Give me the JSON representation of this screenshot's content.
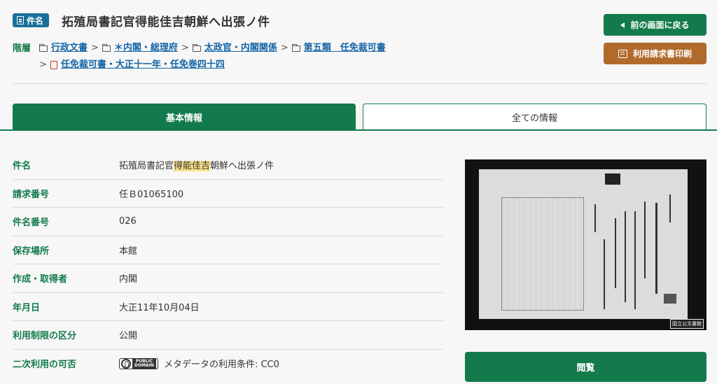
{
  "header": {
    "badge_label": "件名",
    "title": "拓殖局書記官得能佳吉朝鮮へ出張ノ件"
  },
  "breadcrumb": {
    "label": "階層",
    "sep": ">",
    "items": [
      {
        "label": "行政文書",
        "icon": "folder-icon"
      },
      {
        "label": "＊内閣・総理府",
        "icon": "folder-icon"
      },
      {
        "label": "太政官・内閣関係",
        "icon": "folder-icon"
      },
      {
        "label": "第五類　任免裁可書",
        "icon": "folder-icon"
      },
      {
        "label": "任免裁可書・大正十一年・任免巻四十四",
        "icon": "book-icon"
      }
    ]
  },
  "actions": {
    "back_label": "前の画面に戻る",
    "print_label": "利用請求書印刷",
    "view_label": "閲覧"
  },
  "tabs": {
    "basic": "基本情報",
    "all": "全ての情報"
  },
  "metadata": {
    "title_label": "件名",
    "title_pre": "拓殖局書記官",
    "title_hl": "得能佳吉",
    "title_post": "朝鮮へ出張ノ件",
    "request_label": "請求番号",
    "request_value": "任Ｂ01065100",
    "number_label": "件名番号",
    "number_value": "026",
    "location_label": "保存場所",
    "location_value": "本館",
    "creator_label": "作成・取得者",
    "creator_value": "内閣",
    "date_label": "年月日",
    "date_value": "大正11年10月04日",
    "restriction_label": "利用制限の区分",
    "restriction_value": "公開",
    "reuse_label": "二次利用の可否",
    "reuse_value": "メタデータの利用条件: CC0",
    "cc_line1": "PUBLIC",
    "cc_line2": "DOMAIN"
  },
  "thumbnail": {
    "stamp": "国立公文書館"
  },
  "colors": {
    "green": "#137a4c",
    "blue_badge": "#1a6f9c",
    "brown": "#b06a2c",
    "link": "#1565a6",
    "highlight": "#fbe38a"
  }
}
